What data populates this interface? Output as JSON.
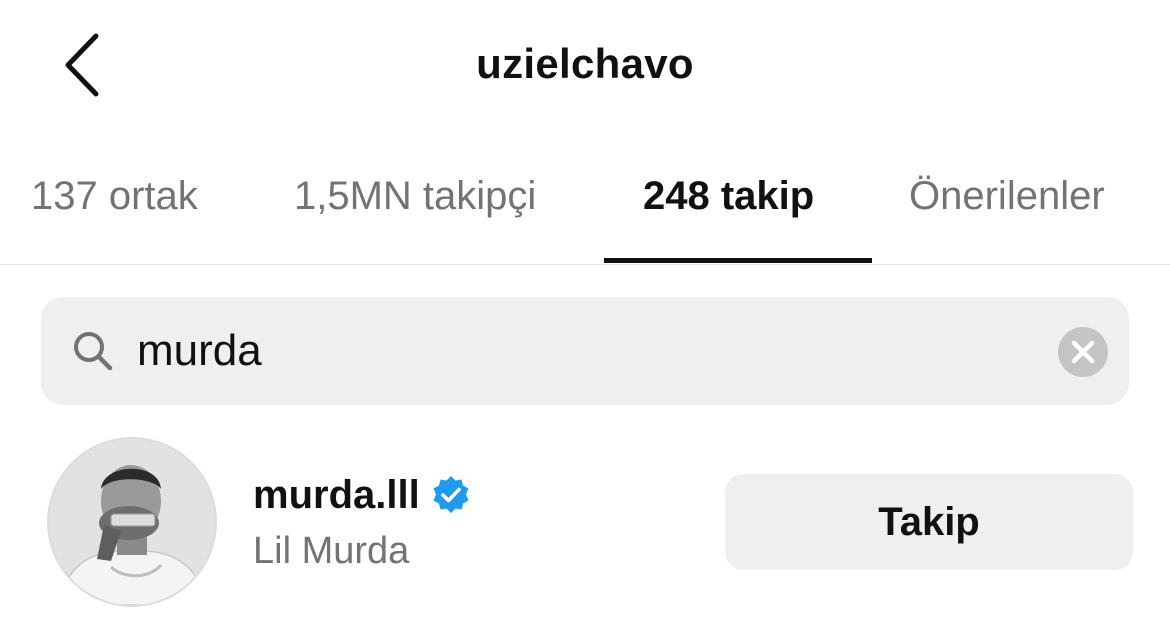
{
  "header": {
    "back_icon": "chevron-left-icon",
    "title": "uzielchavo"
  },
  "tabs": [
    {
      "label": "137 ortak",
      "active": false
    },
    {
      "label": "1,5MN takipçi",
      "active": false
    },
    {
      "label": "248 takip",
      "active": true
    },
    {
      "label": "Önerilenler",
      "active": false
    }
  ],
  "search": {
    "icon": "search-icon",
    "value": "murda",
    "clear_icon": "clear-icon"
  },
  "results": [
    {
      "username": "murda.lll",
      "verified": true,
      "full_name": "Lil Murda",
      "follow_label": "Takip"
    }
  ],
  "colors": {
    "text_primary": "#111111",
    "text_secondary": "#737373",
    "field_bg": "#efefef",
    "verified_blue": "#1d9bf0",
    "clear_bg": "#c4c4c4"
  }
}
